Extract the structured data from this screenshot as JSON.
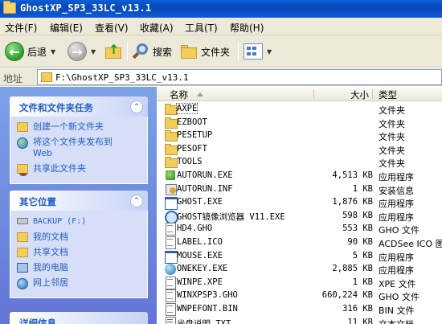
{
  "window": {
    "title": "GhostXP_SP3_33LC_v13.1"
  },
  "menu": [
    "文件(F)",
    "编辑(E)",
    "查看(V)",
    "收藏(A)",
    "工具(T)",
    "帮助(H)"
  ],
  "toolbar": {
    "back": "后退",
    "search": "搜索",
    "folders": "文件夹"
  },
  "address": {
    "label": "地址",
    "value": "F:\\GhostXP_SP3_33LC_v13.1"
  },
  "tasks_panel": {
    "title": "文件和文件夹任务",
    "items": [
      "创建一个新文件夹",
      "将这个文件夹发布到",
      "Web",
      "共享此文件夹"
    ]
  },
  "places_panel": {
    "title": "其它位置",
    "items": [
      "BACKUP (F:)",
      "我的文档",
      "共享文档",
      "我的电脑",
      "网上邻居"
    ]
  },
  "details_panel": {
    "title": "详细信息"
  },
  "columns": {
    "name": "名称",
    "size": "大小",
    "type": "类型"
  },
  "files": [
    {
      "name": "AXPE",
      "size": "",
      "type": "文件夹",
      "icon": "folder-icon"
    },
    {
      "name": "EZBOOT",
      "size": "",
      "type": "文件夹",
      "icon": "folder-icon"
    },
    {
      "name": "PESETUP",
      "size": "",
      "type": "文件夹",
      "icon": "folder-icon"
    },
    {
      "name": "PESOFT",
      "size": "",
      "type": "文件夹",
      "icon": "folder-icon"
    },
    {
      "name": "TOOLS",
      "size": "",
      "type": "文件夹",
      "icon": "folder-icon"
    },
    {
      "name": "AUTORUN.EXE",
      "size": "4,513 KB",
      "type": "应用程序",
      "icon": "exe-icon"
    },
    {
      "name": "AUTORUN.INF",
      "size": "1 KB",
      "type": "安装信息",
      "icon": "inf-icon"
    },
    {
      "name": "GHOST.EXE",
      "size": "1,876 KB",
      "type": "应用程序",
      "icon": "window-icon"
    },
    {
      "name": "GHOST镜像浏览器 V11.EXE",
      "size": "598 KB",
      "type": "应用程序",
      "icon": "viewer-icon"
    },
    {
      "name": "HD4.GHO",
      "size": "553 KB",
      "type": "GHO 文件",
      "icon": "doc-icon"
    },
    {
      "name": "LABEL.ICO",
      "size": "90 KB",
      "type": "ACDSee ICO 图像",
      "icon": "doc-icon"
    },
    {
      "name": "MOUSE.EXE",
      "size": "5 KB",
      "type": "应用程序",
      "icon": "window-icon"
    },
    {
      "name": "ONEKEY.EXE",
      "size": "2,885 KB",
      "type": "应用程序",
      "icon": "globe-icon"
    },
    {
      "name": "WINPE.XPE",
      "size": "1 KB",
      "type": "XPE 文件",
      "icon": "doc-icon"
    },
    {
      "name": "WINXPSP3.GHO",
      "size": "660,224 KB",
      "type": "GHO 文件",
      "icon": "doc-icon"
    },
    {
      "name": "WNPEFONT.BIN",
      "size": "316 KB",
      "type": "BIN 文件",
      "icon": "doc-icon"
    },
    {
      "name": "光盘说明.TXT",
      "size": "11 KB",
      "type": "文本文档",
      "icon": "text-file-icon"
    }
  ]
}
